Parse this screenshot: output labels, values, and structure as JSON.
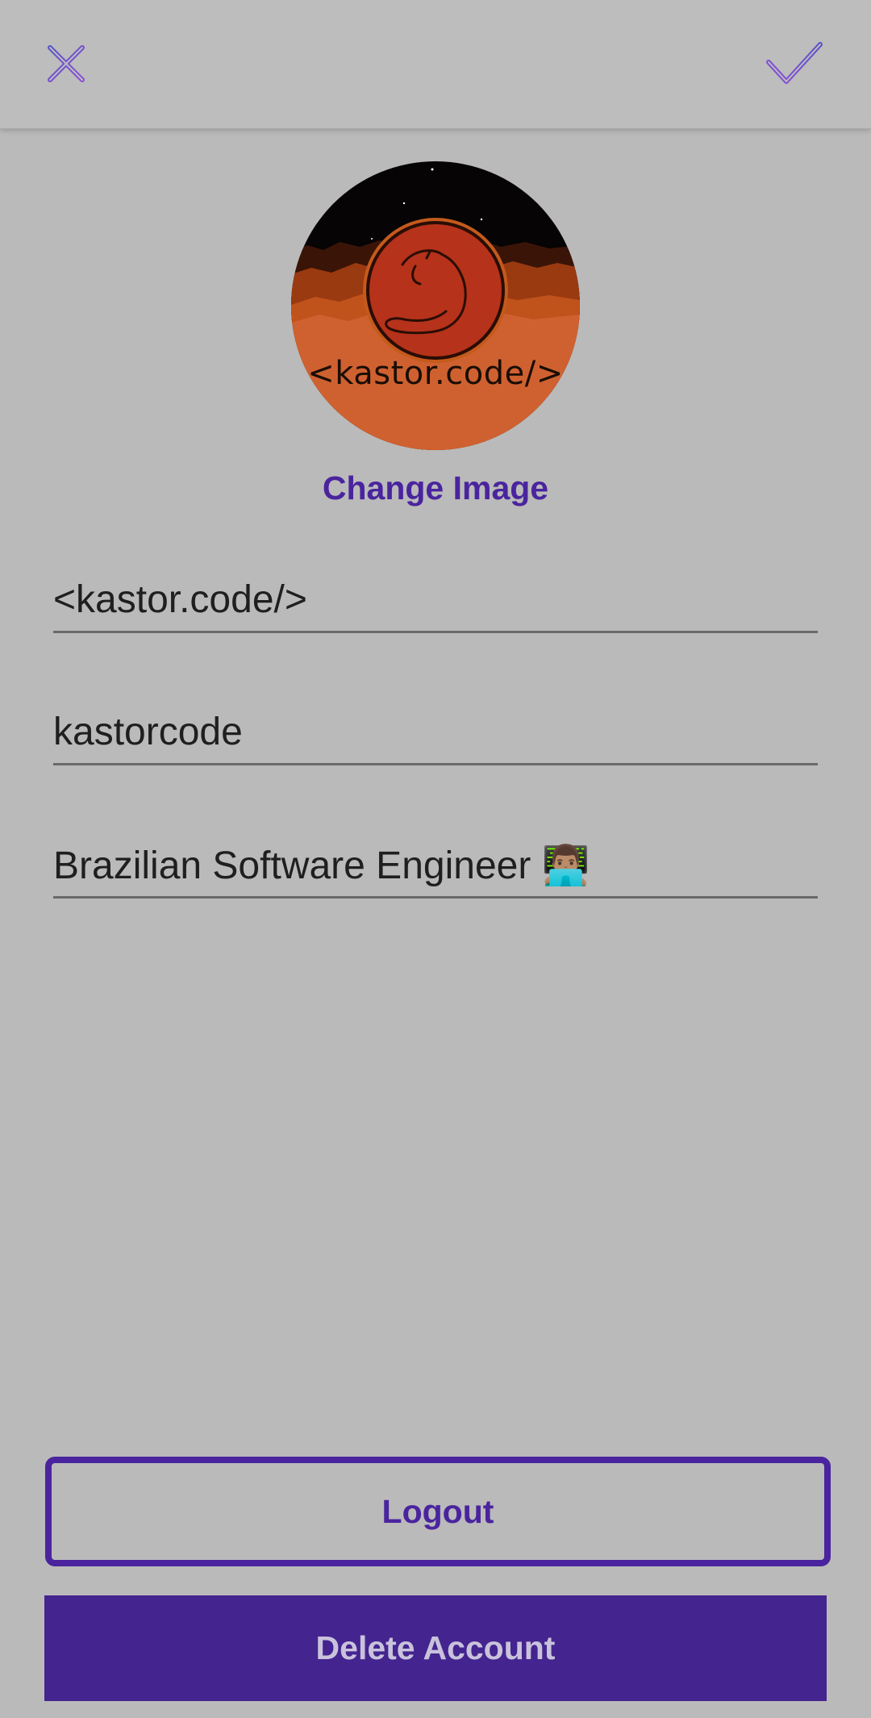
{
  "header": {
    "close_icon": "close-icon",
    "confirm_icon": "check-icon"
  },
  "profile": {
    "avatar_text": "<kastor.code/>",
    "change_image_label": "Change Image"
  },
  "form": {
    "name_value": "<kastor.code/>",
    "username_value": "kastorcode",
    "bio_value": "Brazilian Software Engineer 👨🏽‍💻"
  },
  "actions": {
    "logout_label": "Logout",
    "delete_label": "Delete Account"
  },
  "colors": {
    "accent": "#4a249e",
    "background": "#bababa",
    "delete_bg": "#44248f",
    "delete_text": "#c9c2dc"
  }
}
